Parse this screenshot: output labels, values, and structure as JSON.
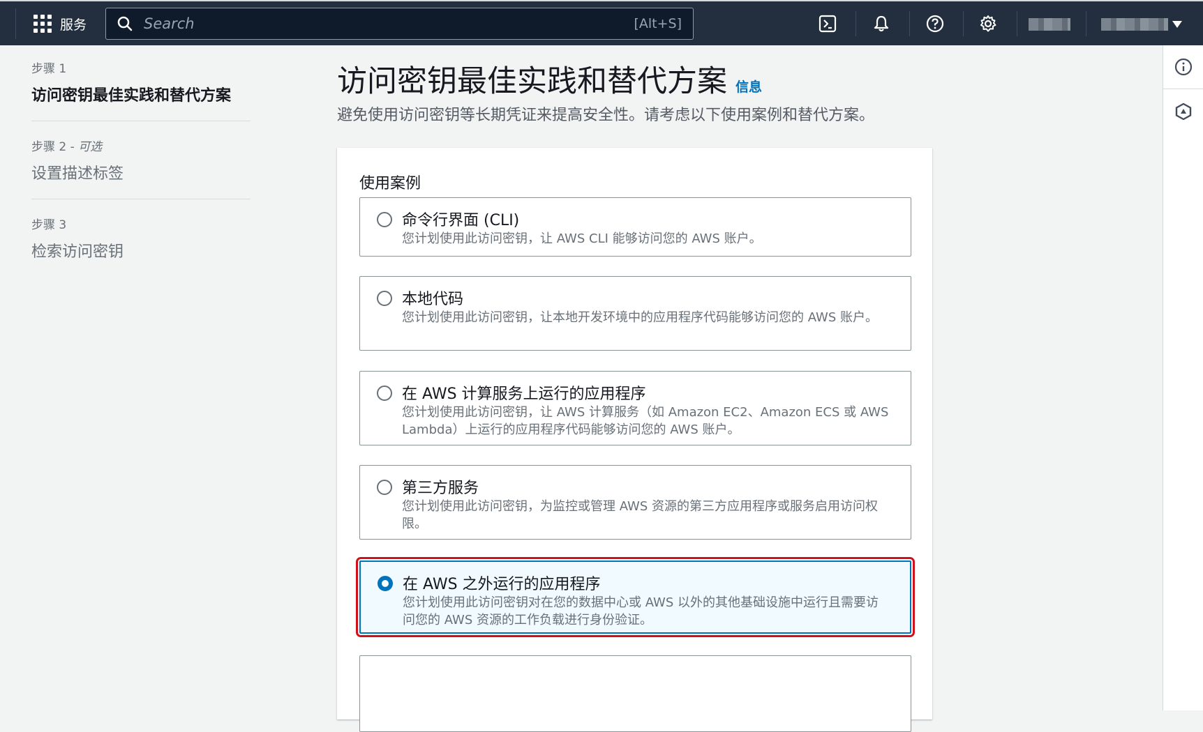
{
  "topnav": {
    "services_label": "服务",
    "search_placeholder": "Search",
    "search_shortcut": "[Alt+S]",
    "icons": [
      "cloudshell-icon",
      "bell-icon",
      "help-icon",
      "gear-icon"
    ]
  },
  "sidebar": {
    "steps": [
      {
        "number": "步骤 1",
        "optional": "",
        "title": "访问密钥最佳实践和替代方案",
        "active": true
      },
      {
        "number": "步骤 2 - ",
        "optional": "可选",
        "title": "设置描述标签",
        "active": false
      },
      {
        "number": "步骤 3",
        "optional": "",
        "title": "检索访问密钥",
        "active": false
      }
    ]
  },
  "header": {
    "title": "访问密钥最佳实践和替代方案",
    "info_link": "信息",
    "description": "避免使用访问密钥等长期凭证来提高安全性。请考虑以下使用案例和替代方案。"
  },
  "use_cases": {
    "label": "使用案例",
    "options": [
      {
        "title": "命令行界面 (CLI)",
        "description": "您计划使用此访问密钥，让 AWS CLI 能够访问您的 AWS 账户。",
        "selected": false
      },
      {
        "title": "本地代码",
        "description": "您计划使用此访问密钥，让本地开发环境中的应用程序代码能够访问您的 AWS 账户。",
        "selected": false
      },
      {
        "title": "在 AWS 计算服务上运行的应用程序",
        "description": "您计划使用此访问密钥，让 AWS 计算服务（如 Amazon EC2、Amazon ECS 或 AWS Lambda）上运行的应用程序代码能够访问您的 AWS 账户。",
        "selected": false
      },
      {
        "title": "第三方服务",
        "description": "您计划使用此访问密钥，为监控或管理 AWS 资源的第三方应用程序或服务启用访问权限。",
        "selected": false
      },
      {
        "title": "在 AWS 之外运行的应用程序",
        "description": "您计划使用此访问密钥对在您的数据中心或 AWS 以外的其他基础设施中运行且需要访问您的 AWS 资源的工作负载进行身份验证。",
        "selected": true
      }
    ]
  },
  "colors": {
    "nav_bg": "#232f3e",
    "accent": "#0073bb",
    "highlight_frame": "#d0101b"
  }
}
